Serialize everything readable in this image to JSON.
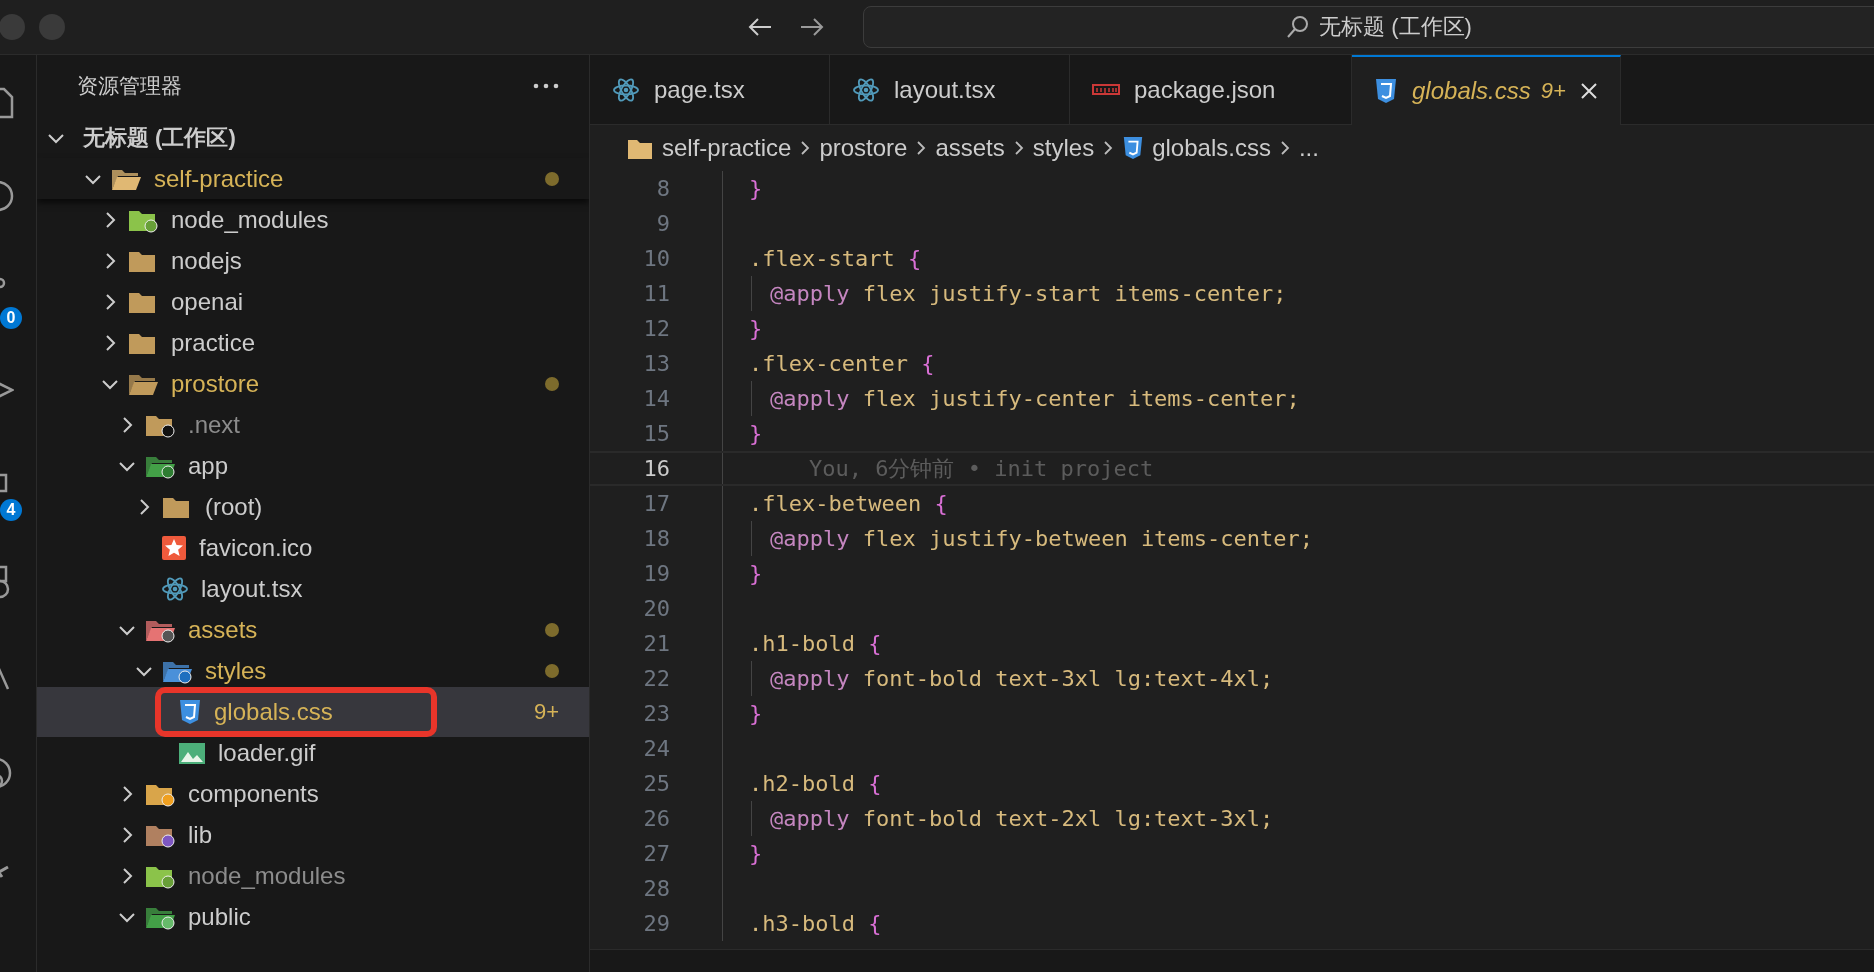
{
  "title_bar": {
    "search": "无标题 (工作区)"
  },
  "activity_bar": [
    {
      "kind": "files"
    },
    {
      "kind": "search"
    },
    {
      "kind": "source-control",
      "badge": "0"
    },
    {
      "kind": "run"
    },
    {
      "kind": "extensions",
      "badge": "4"
    },
    {
      "kind": "history"
    },
    {
      "kind": "warning"
    },
    {
      "kind": "account"
    },
    {
      "kind": "pin"
    }
  ],
  "explorer": {
    "title": "资源管理器",
    "workspace": {
      "label": "无标题 (工作区)",
      "expanded": true,
      "children": [
        {
          "label": "self-practice",
          "kind": "workspace-folder",
          "expanded": true,
          "modified": true,
          "selected": false,
          "children": [
            {
              "label": "node_modules",
              "kind": "node-folder",
              "expanded": false,
              "selected": false
            },
            {
              "label": "nodejs",
              "kind": "folder",
              "expanded": false,
              "selected": false
            },
            {
              "label": "openai",
              "kind": "folder",
              "expanded": false,
              "selected": false
            },
            {
              "label": "practice",
              "kind": "folder",
              "expanded": false,
              "selected": false
            },
            {
              "label": "prostore",
              "kind": "folder",
              "expanded": true,
              "modified": true,
              "selected": false,
              "children": [
                {
                  "label": ".next",
                  "kind": "next-folder",
                  "expanded": false,
                  "ignored": true,
                  "selected": false
                },
                {
                  "label": "app",
                  "kind": "app-folder",
                  "expanded": true,
                  "selected": false,
                  "children": [
                    {
                      "label": "(root)",
                      "kind": "folder",
                      "expanded": false,
                      "selected": false
                    },
                    {
                      "label": "favicon.ico",
                      "kind": "star-file",
                      "selected": false
                    },
                    {
                      "label": "layout.tsx",
                      "kind": "react-file",
                      "selected": false
                    }
                  ]
                },
                {
                  "label": "assets",
                  "kind": "assets-folder",
                  "expanded": true,
                  "modified": true,
                  "selected": false,
                  "children": [
                    {
                      "label": "styles",
                      "kind": "styles-folder",
                      "expanded": true,
                      "modified": true,
                      "selected": false,
                      "children": [
                        {
                          "label": "globals.css",
                          "kind": "css-file",
                          "modified": true,
                          "selected": true,
                          "highlighted": true,
                          "badge": "9+"
                        },
                        {
                          "label": "loader.gif",
                          "kind": "image-file",
                          "selected": false
                        }
                      ]
                    }
                  ]
                },
                {
                  "label": "components",
                  "kind": "components-folder",
                  "expanded": false,
                  "selected": false
                },
                {
                  "label": "lib",
                  "kind": "lib-folder",
                  "expanded": false,
                  "selected": false
                },
                {
                  "label": "node_modules",
                  "kind": "node-folder",
                  "expanded": false,
                  "ignored": true,
                  "selected": false
                },
                {
                  "label": "public",
                  "kind": "public-folder",
                  "expanded": true,
                  "selected": false
                }
              ]
            }
          ]
        }
      ]
    }
  },
  "tabs": [
    {
      "label": "page.tsx",
      "kind": "react",
      "selected": false
    },
    {
      "label": "layout.tsx",
      "kind": "react",
      "selected": false
    },
    {
      "label": "package.json",
      "kind": "npm",
      "selected": false
    },
    {
      "label": "globals.css",
      "kind": "css",
      "selected": true,
      "preview": true,
      "modified": true,
      "badge": "9+"
    }
  ],
  "breadcrumbs": [
    {
      "label": "self-practice",
      "kind": "folder"
    },
    {
      "label": "prostore",
      "kind": "text"
    },
    {
      "label": "assets",
      "kind": "text"
    },
    {
      "label": "styles",
      "kind": "text"
    },
    {
      "label": "globals.css",
      "kind": "css"
    },
    {
      "label": "...",
      "kind": "text"
    }
  ],
  "lines": [
    {
      "number": "8",
      "tokens": [
        {
          "kind": "brace",
          "text": "}"
        }
      ]
    },
    {
      "number": "9"
    },
    {
      "number": "10",
      "tokens": [
        {
          "kind": "selector",
          "text": ".flex-start"
        },
        {
          "kind": "brace",
          "text": " {"
        }
      ]
    },
    {
      "number": "11",
      "indented": true,
      "tokens": [
        {
          "kind": "at-rule",
          "text": "@apply"
        },
        {
          "kind": "value",
          "text": " flex justify-start items-center;"
        }
      ]
    },
    {
      "number": "12",
      "tokens": [
        {
          "kind": "brace",
          "text": "}"
        }
      ]
    },
    {
      "number": "13",
      "tokens": [
        {
          "kind": "selector",
          "text": ".flex-center"
        },
        {
          "kind": "brace",
          "text": " {"
        }
      ]
    },
    {
      "number": "14",
      "indented": true,
      "tokens": [
        {
          "kind": "at-rule",
          "text": "@apply"
        },
        {
          "kind": "value",
          "text": " flex justify-center items-center;"
        }
      ]
    },
    {
      "number": "15",
      "tokens": [
        {
          "kind": "brace",
          "text": "}"
        }
      ]
    },
    {
      "number": "16",
      "current": true,
      "blame": "You, 6分钟前 • init project"
    },
    {
      "number": "17",
      "tokens": [
        {
          "kind": "selector",
          "text": ".flex-between"
        },
        {
          "kind": "brace",
          "text": " {"
        }
      ]
    },
    {
      "number": "18",
      "indented": true,
      "tokens": [
        {
          "kind": "at-rule",
          "text": "@apply"
        },
        {
          "kind": "value",
          "text": " flex justify-between items-center;"
        }
      ]
    },
    {
      "number": "19",
      "tokens": [
        {
          "kind": "brace",
          "text": "}"
        }
      ]
    },
    {
      "number": "20"
    },
    {
      "number": "21",
      "tokens": [
        {
          "kind": "selector",
          "text": ".h1-bold"
        },
        {
          "kind": "brace",
          "text": " {"
        }
      ]
    },
    {
      "number": "22",
      "indented": true,
      "tokens": [
        {
          "kind": "at-rule",
          "text": "@apply"
        },
        {
          "kind": "value",
          "text": " font-bold text-3xl lg:text-4xl;"
        }
      ]
    },
    {
      "number": "23",
      "tokens": [
        {
          "kind": "brace",
          "text": "}"
        }
      ]
    },
    {
      "number": "24"
    },
    {
      "number": "25",
      "tokens": [
        {
          "kind": "selector",
          "text": ".h2-bold"
        },
        {
          "kind": "brace",
          "text": " {"
        }
      ]
    },
    {
      "number": "26",
      "indented": true,
      "tokens": [
        {
          "kind": "at-rule",
          "text": "@apply"
        },
        {
          "kind": "value",
          "text": " font-bold text-2xl lg:text-3xl;"
        }
      ]
    },
    {
      "number": "27",
      "tokens": [
        {
          "kind": "brace",
          "text": "}"
        }
      ]
    },
    {
      "number": "28"
    },
    {
      "number": "29",
      "tokens": [
        {
          "kind": "selector",
          "text": ".h3-bold"
        },
        {
          "kind": "brace",
          "text": " {"
        }
      ]
    }
  ]
}
